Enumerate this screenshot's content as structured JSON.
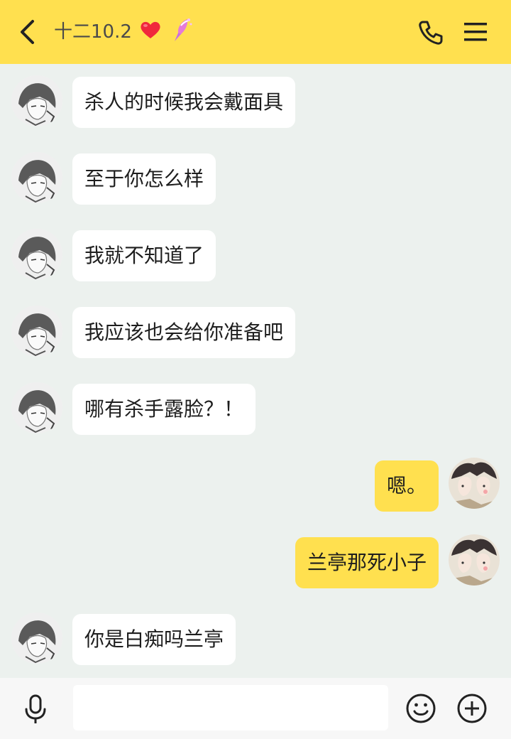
{
  "header": {
    "title": "十二10.2",
    "icons": [
      "back-chevron-icon",
      "heart-icon",
      "sparkle-icon",
      "phone-icon",
      "menu-icon"
    ],
    "background_color": "#ffe04f"
  },
  "messages": [
    {
      "side": "left",
      "text": "杀人的时候我会戴面具"
    },
    {
      "side": "left",
      "text": "至于你怎么样"
    },
    {
      "side": "left",
      "text": "我就不知道了"
    },
    {
      "side": "left",
      "text": "我应该也会给你准备吧"
    },
    {
      "side": "left",
      "text": "哪有杀手露脸？！"
    },
    {
      "side": "right",
      "text": "嗯。"
    },
    {
      "side": "right",
      "text": "兰亭那死小子"
    },
    {
      "side": "left",
      "text": "你是白痴吗兰亭"
    }
  ],
  "input_bar": {
    "placeholder": "",
    "value": "",
    "icons": [
      "microphone-icon",
      "emoji-icon",
      "plus-icon"
    ]
  },
  "colors": {
    "chat_background": "#ecf1ee",
    "incoming_bubble": "#ffffff",
    "outgoing_bubble": "#ffe04f"
  }
}
